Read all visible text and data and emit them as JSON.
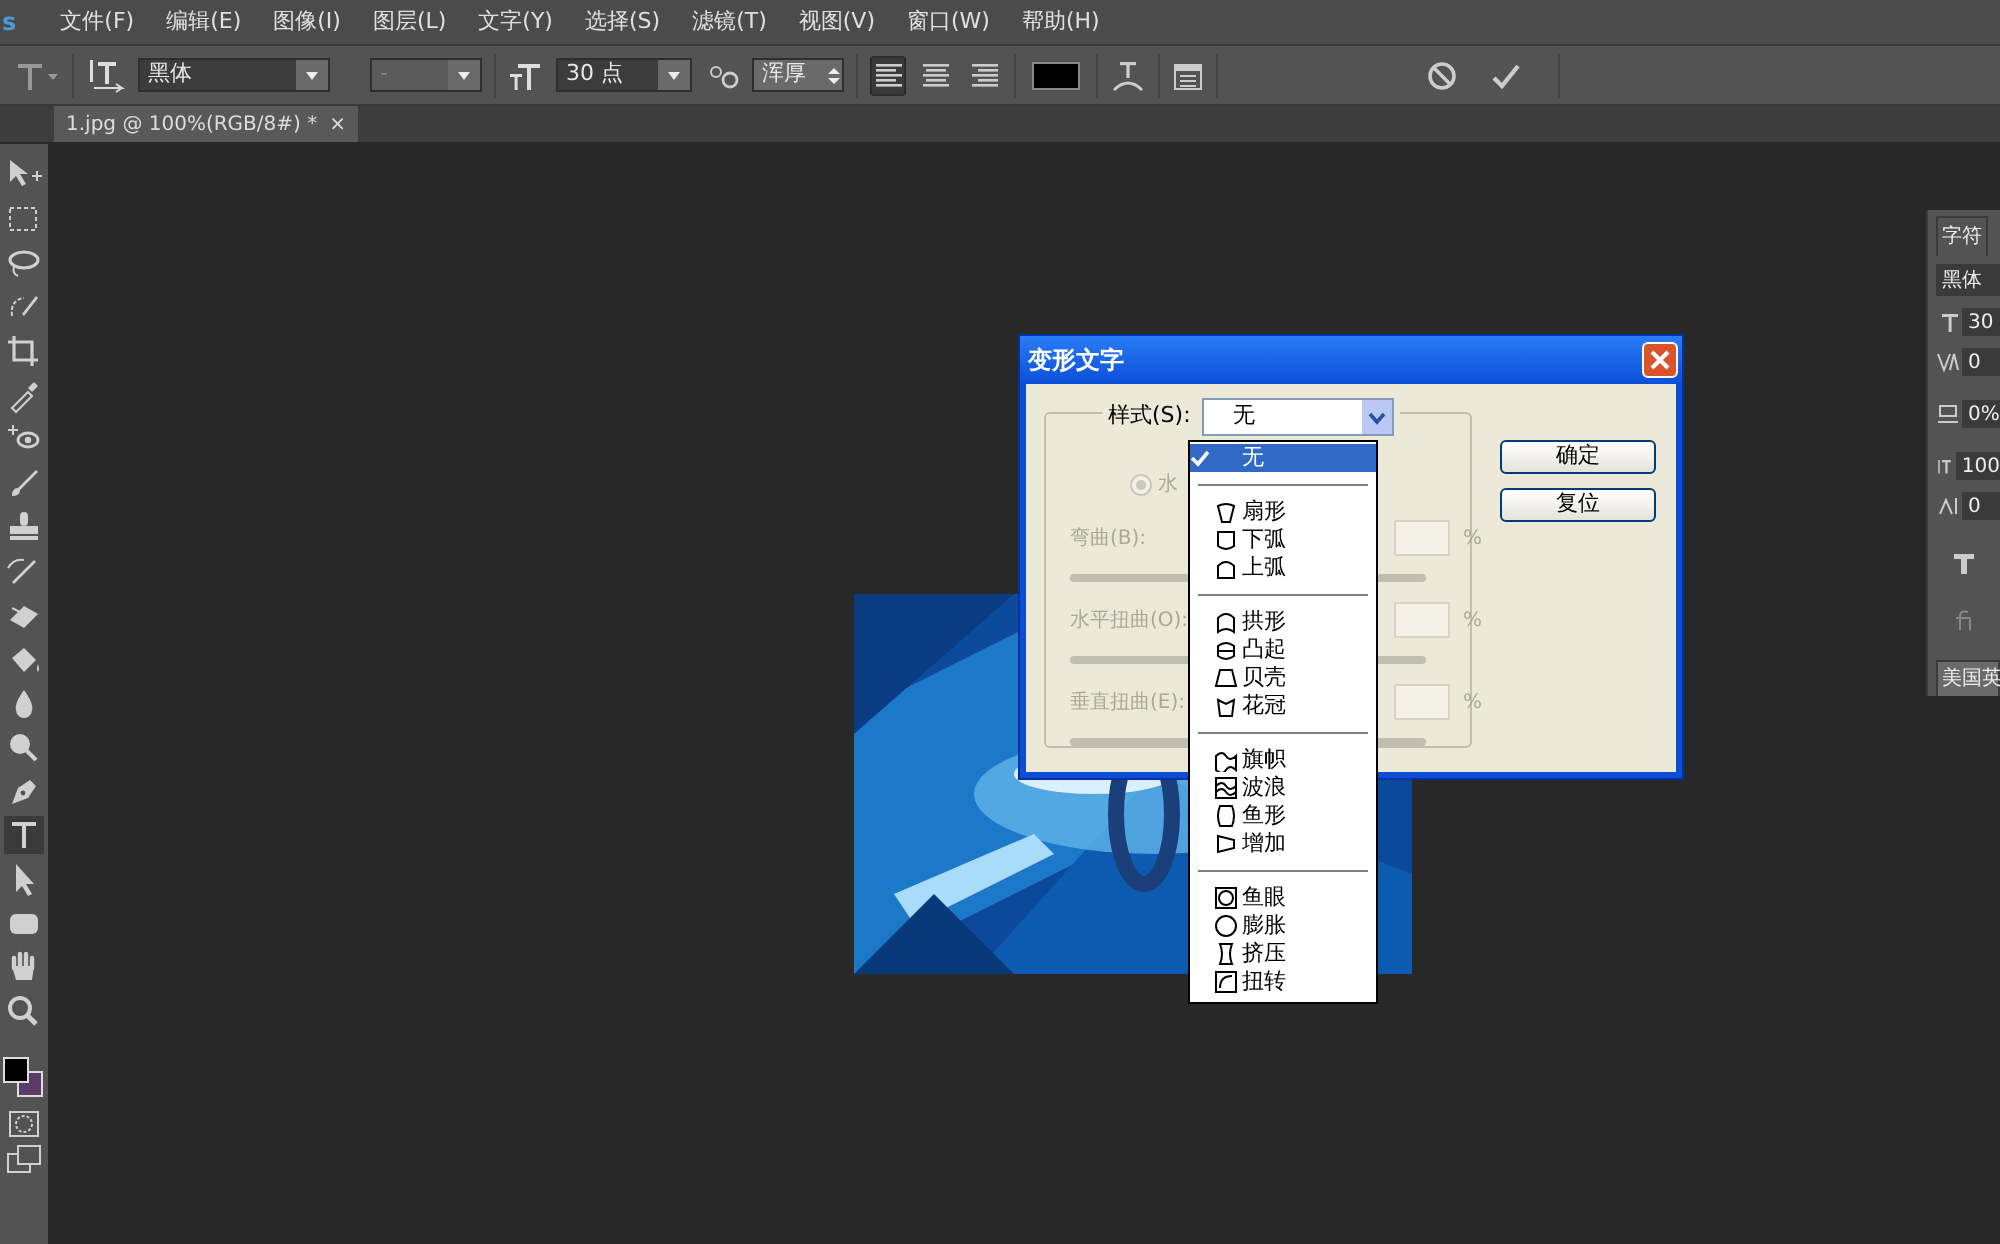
{
  "app": {
    "logo": "s"
  },
  "menu": [
    "文件(F)",
    "编辑(E)",
    "图像(I)",
    "图层(L)",
    "文字(Y)",
    "选择(S)",
    "滤镜(T)",
    "视图(V)",
    "窗口(W)",
    "帮助(H)"
  ],
  "options_bar": {
    "font_family": "黑体",
    "font_style": "-",
    "font_size": "30 点",
    "antialias": "浑厚",
    "align": [
      {
        "selected": true
      },
      {
        "selected": false
      },
      {
        "selected": false
      }
    ]
  },
  "document_tab": {
    "title": "1.jpg @ 100%(RGB/8#) *",
    "close": "×"
  },
  "tools": [
    {
      "selected": false
    },
    {
      "selected": false
    },
    {
      "selected": false
    },
    {
      "selected": false
    },
    {
      "selected": false
    },
    {
      "selected": false
    },
    {
      "selected": false
    },
    {
      "selected": false
    },
    {
      "selected": false
    },
    {
      "selected": false
    },
    {
      "selected": false
    },
    {
      "selected": false
    },
    {
      "selected": false
    },
    {
      "selected": false
    },
    {
      "selected": false
    },
    {
      "selected": true
    },
    {
      "selected": false
    },
    {
      "selected": false
    },
    {
      "selected": false
    },
    {
      "selected": false
    }
  ],
  "dialog": {
    "title": "变形文字",
    "style_label": "样式(S):",
    "style_value": "无",
    "radio": {
      "label": "水",
      "checked": true,
      "disabled": true
    },
    "fields": [
      {
        "label": "弯曲(B):",
        "unit": "%",
        "disabled": true
      },
      {
        "label": "水平扭曲(O):",
        "unit": "%",
        "disabled": true
      },
      {
        "label": "垂直扭曲(E):",
        "unit": "%",
        "disabled": true
      }
    ],
    "buttons": [
      "确定",
      "复位"
    ]
  },
  "style_menu": {
    "groups": [
      [
        {
          "label": "无",
          "selected": true
        }
      ],
      [
        {
          "label": "扇形",
          "selected": false
        },
        {
          "label": "下弧",
          "selected": false
        },
        {
          "label": "上弧",
          "selected": false
        }
      ],
      [
        {
          "label": "拱形",
          "selected": false
        },
        {
          "label": "凸起",
          "selected": false
        },
        {
          "label": "贝壳",
          "selected": false
        },
        {
          "label": "花冠",
          "selected": false
        }
      ],
      [
        {
          "label": "旗帜",
          "selected": false
        },
        {
          "label": "波浪",
          "selected": false
        },
        {
          "label": "鱼形",
          "selected": false
        },
        {
          "label": "增加",
          "selected": false
        }
      ],
      [
        {
          "label": "鱼眼",
          "selected": false
        },
        {
          "label": "膨胀",
          "selected": false
        },
        {
          "label": "挤压",
          "selected": false
        },
        {
          "label": "扭转",
          "selected": false
        }
      ]
    ]
  },
  "character_panel": {
    "tab": "字符",
    "font": "黑体",
    "values": [
      "30",
      "0",
      "0%",
      "100",
      "0"
    ],
    "language": "美国英"
  }
}
